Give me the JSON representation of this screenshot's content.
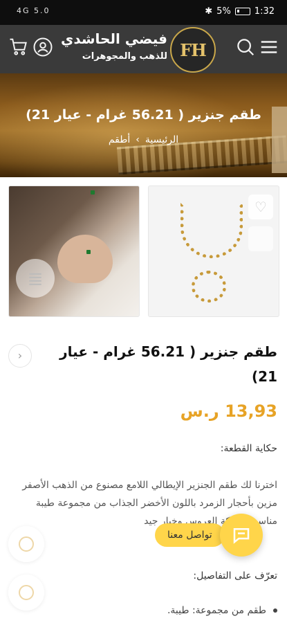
{
  "status_bar": {
    "signal": "4G 5.0",
    "battery": "5%",
    "time": "1:32"
  },
  "header": {
    "logo_letters": "FH",
    "brand_name": "فيضي الحاشدي",
    "brand_tagline": "للذهب والمجوهرات",
    "icons": [
      "menu-icon",
      "search-icon",
      "account-icon",
      "cart-icon"
    ]
  },
  "hero": {
    "title": "طقم جنزير ( 56.21 غرام - عيار 21)",
    "breadcrumb": {
      "home": "الرئيسية",
      "separator": "›",
      "current": "أطقم"
    }
  },
  "product": {
    "title": "طقم جنزير ( 56.21 غرام - عيار 21)",
    "price": "13,93 ر.س",
    "story_label": "حكاية القطعة:",
    "story_text": "اخترنا لك طقم الجنزير الإيطالي اللامع مصنوع من الذهب الأصفر مزين بأحجار الزمرد باللون الأخضر الجذاب من مجموعة طيبة مناسب لشبكة العروس وخيار جيد",
    "details_label": "تعرّف على التفاصيل:",
    "details": [
      "طقم من مجموعة: طيبة."
    ]
  },
  "chat": {
    "label": "تواصل معنا"
  },
  "colors": {
    "header_bg": "#3a3a3a",
    "gold": "#c9a74a",
    "price": "#e7a326",
    "chat": "#ffd54a"
  }
}
